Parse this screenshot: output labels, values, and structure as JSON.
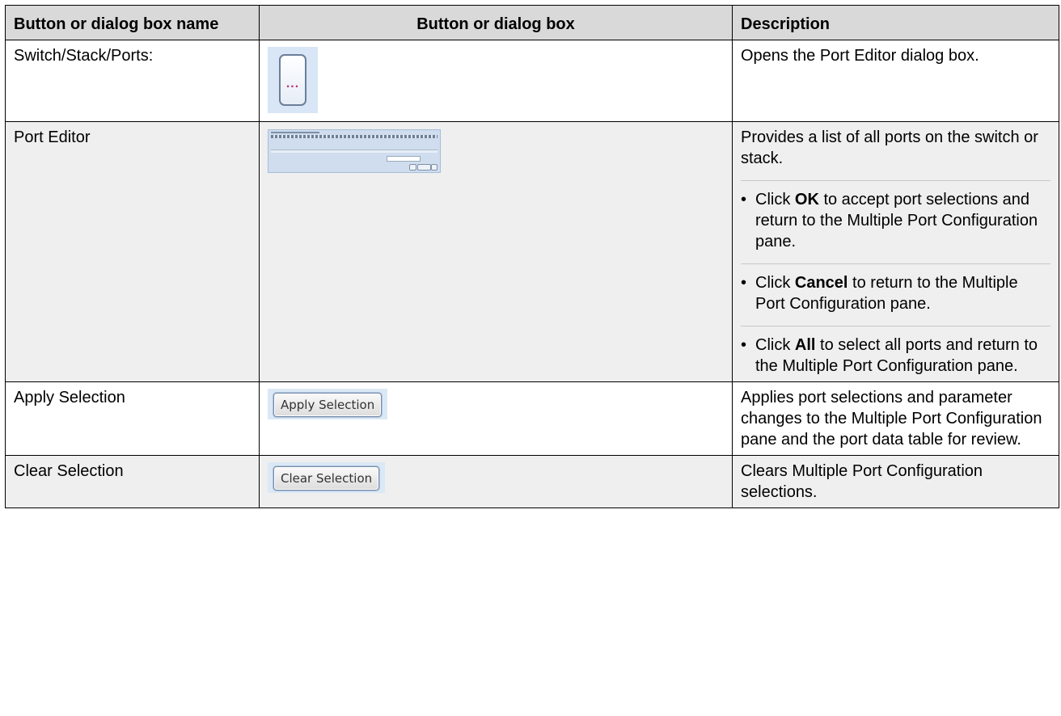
{
  "table": {
    "headers": [
      "Button or dialog box name",
      "Button or dialog box",
      "Description"
    ],
    "rows": [
      {
        "name": "Switch/Stack/Ports:",
        "image": {
          "type": "ellipsis-button",
          "label": "..."
        },
        "description": "Opens the Port Editor dialog box."
      },
      {
        "name": "Port Editor",
        "image": {
          "type": "port-editor-dialog-thumbnail"
        },
        "description": "Provides a list of all ports on the switch or stack.",
        "bullets": [
          {
            "pre": "Click ",
            "bold": "OK",
            "post": " to accept port selections and return to the Multiple Port Configuration pane."
          },
          {
            "pre": "Click ",
            "bold": "Cancel",
            "post": " to return to the Multiple Port Configuration pane."
          },
          {
            "pre": "Click ",
            "bold": "All",
            "post": " to select all ports and return to the Multiple Port Configuration pane."
          }
        ]
      },
      {
        "name": "Apply Selection",
        "image": {
          "type": "push-button",
          "label": "Apply Selection"
        },
        "description": "Applies port selections and parameter changes to the Multiple Port Configuration pane and the port data table for review."
      },
      {
        "name": "Clear Selection",
        "image": {
          "type": "push-button",
          "label": "Clear Selection"
        },
        "description": "Clears Multiple Port Configuration selections."
      }
    ]
  },
  "colors": {
    "header_bg": "#d9d9d9",
    "shaded_row_bg": "#efefef",
    "border": "#000000",
    "button_frame": "#dbe8f5"
  }
}
